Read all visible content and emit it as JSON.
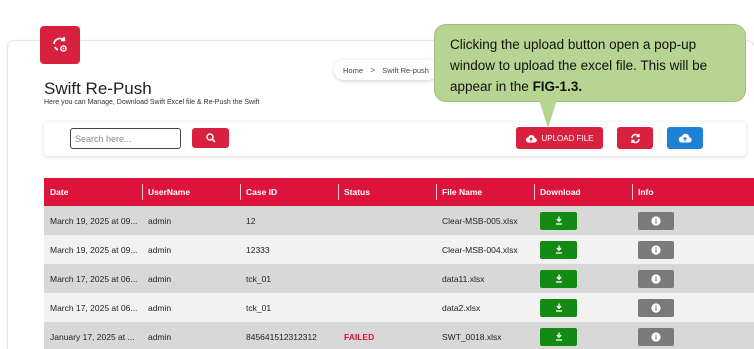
{
  "page": {
    "title": "Swift Re-Push",
    "subtitle": "Here you can Manage, Download Swift Excel file & Re-Push the Swift"
  },
  "breadcrumb": {
    "home": "Home",
    "separator": ">",
    "current": "Swift Re-push"
  },
  "callout": {
    "text": "Clicking the upload button open a pop-up window to upload the excel file. This will be appear in the ",
    "figure_ref": "FIG-1.3."
  },
  "toolbar": {
    "search_placeholder": "Search here...",
    "upload_label": "UPLOAD FILE"
  },
  "table": {
    "headers": {
      "date": "Date",
      "username": "UserName",
      "case_id": "Case ID",
      "status": "Status",
      "file_name": "File Name",
      "download": "Download",
      "info": "Info"
    },
    "rows": [
      {
        "date": "March 19, 2025 at 09...",
        "username": "admin",
        "case_id": "12",
        "status": "",
        "file_name": "Clear-MSB-005.xlsx"
      },
      {
        "date": "March 19, 2025 at 09...",
        "username": "admin",
        "case_id": "12333",
        "status": "",
        "file_name": "Clear-MSB-004.xlsx"
      },
      {
        "date": "March 17, 2025 at 06...",
        "username": "admin",
        "case_id": "tck_01",
        "status": "",
        "file_name": "data11.xlsx"
      },
      {
        "date": "March 17, 2025 at 06...",
        "username": "admin",
        "case_id": "tck_01",
        "status": "",
        "file_name": "data2.xlsx"
      },
      {
        "date": "January 17, 2025 at ...",
        "username": "admin",
        "case_id": "845641512312312",
        "status": "FAILED",
        "file_name": "SWT_0018.xlsx"
      }
    ]
  },
  "colors": {
    "brand_red": "#dc143c",
    "download_green": "#138a13",
    "info_gray": "#7a7a7a",
    "blue_button": "#1e82d4",
    "callout_green": "#b8d493"
  },
  "icons": {
    "logo": "sync-settings-icon",
    "search": "search-icon",
    "upload": "cloud-upload-icon",
    "refresh": "refresh-icon",
    "cloud": "cloud-upload-icon",
    "download": "download-icon",
    "info": "info-icon"
  }
}
